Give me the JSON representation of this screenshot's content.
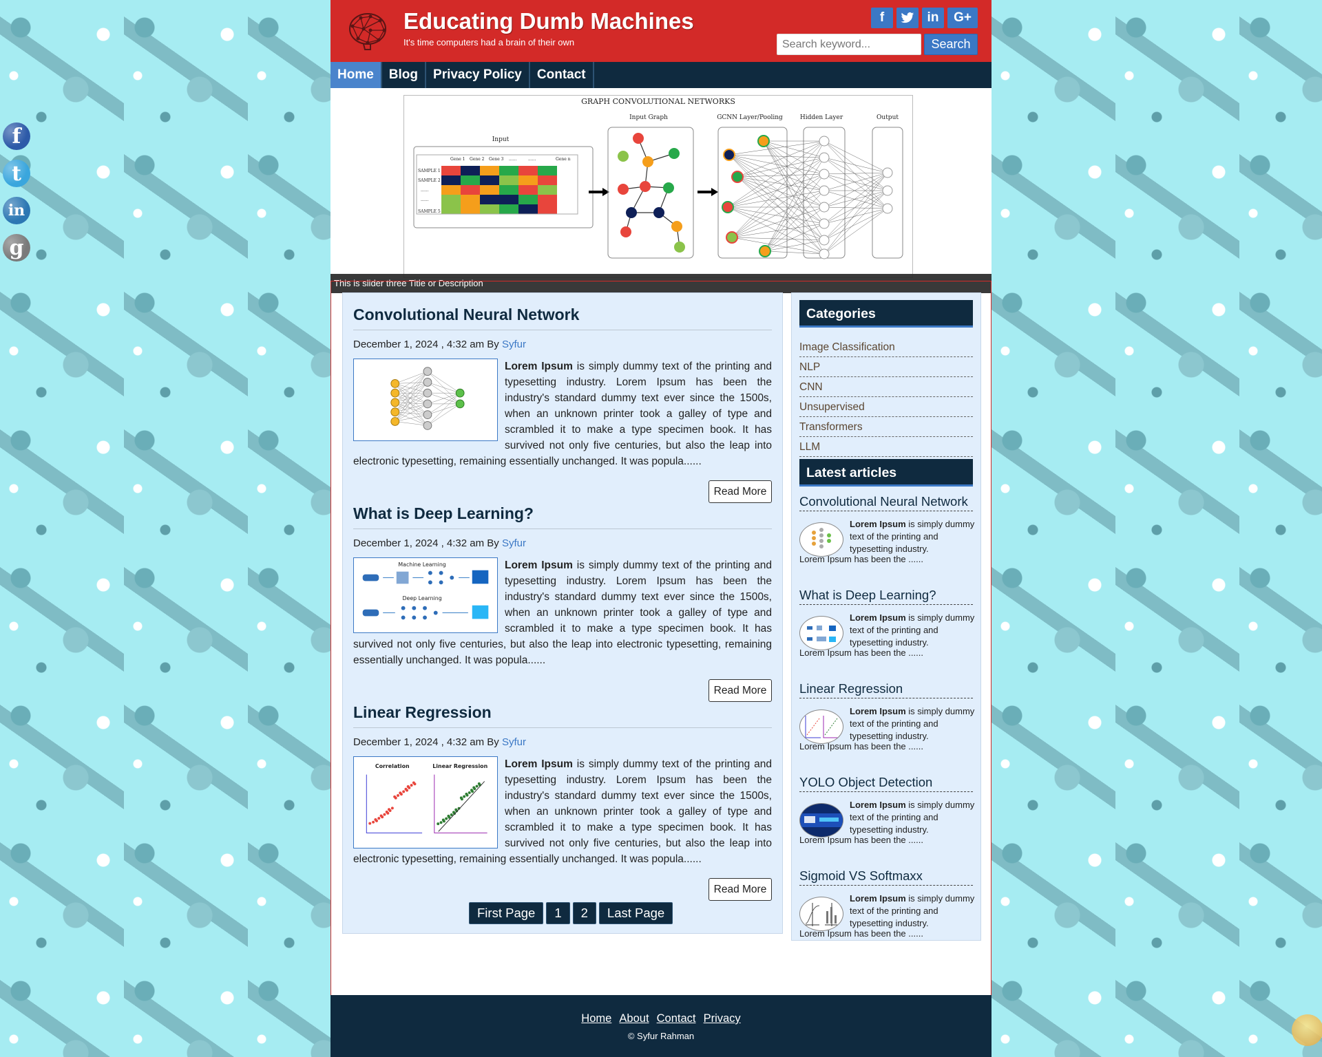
{
  "site": {
    "title": "Educating Dumb Machines",
    "tagline": "It's time computers had a brain of their own"
  },
  "search": {
    "placeholder": "Search keyword...",
    "button": "Search"
  },
  "header_social": [
    "f",
    "t",
    "in",
    "G+"
  ],
  "side_social": [
    "facebook-icon",
    "twitter-icon",
    "linkedin-icon",
    "google-icon"
  ],
  "nav": [
    {
      "label": "Home",
      "active": true
    },
    {
      "label": "Blog",
      "active": false
    },
    {
      "label": "Privacy Policy",
      "active": false
    },
    {
      "label": "Contact",
      "active": false
    }
  ],
  "slider": {
    "caption": "This is slider three Title or Description",
    "diagram_title": "GRAPH CONVOLUTIONAL NETWORKS",
    "labels": [
      "Input",
      "Input Graph",
      "GCNN Layer/Pooling",
      "Hidden Layer",
      "Output"
    ],
    "table_head": [
      "Gene 1",
      "Gene 2",
      "Gene 3",
      "......",
      "......",
      "Gene n"
    ],
    "table_rows": [
      "SAMPLE 1",
      "SAMPLE 2",
      "......",
      "......",
      "SAMPLE 5"
    ]
  },
  "posts": [
    {
      "title": "Convolutional Neural Network",
      "date": "December 1, 2024 , 4:32 am",
      "by": "By",
      "author": "Syfur",
      "lead": "Lorem Ipsum",
      "body": " is simply dummy text of the printing and typesetting industry. Lorem Ipsum has been the industry's standard dummy text ever since the 1500s, when an unknown printer took a galley of type and scrambled it to make a type specimen book. It has survived not only five centuries, but also the leap into electronic typesetting, remaining essentially unchanged. It was popula......",
      "read_more": "Read More"
    },
    {
      "title": "What is Deep Learning?",
      "date": "December 1, 2024 , 4:32 am",
      "by": "By",
      "author": "Syfur",
      "lead": "Lorem Ipsum",
      "body": " is simply dummy text of the printing and typesetting industry. Lorem Ipsum has been the industry's standard dummy text ever since the 1500s, when an unknown printer took a galley of type and scrambled it to make a type specimen book. It has survived not only five centuries, but also the leap into electronic typesetting, remaining essentially unchanged. It was popula......",
      "read_more": "Read More",
      "thumb_labels": [
        "Machine Learning",
        "Deep Learning"
      ]
    },
    {
      "title": "Linear Regression",
      "date": "December 1, 2024 , 4:32 am",
      "by": "By",
      "author": "Syfur",
      "lead": "Lorem Ipsum",
      "body": " is simply dummy text of the printing and typesetting industry. Lorem Ipsum has been the industry's standard dummy text ever since the 1500s, when an unknown printer took a galley of type and scrambled it to make a type specimen book. It has survived not only five centuries, but also the leap into electronic typesetting, remaining essentially unchanged. It was popula......",
      "read_more": "Read More",
      "thumb_labels": [
        "Correlation",
        "Linear Regression"
      ]
    }
  ],
  "pagination": [
    "First Page",
    "1",
    "2",
    "Last Page"
  ],
  "categories": {
    "title": "Categories",
    "items": [
      "Image Classification",
      "NLP",
      "CNN",
      "Unsupervised",
      "Transformers",
      "LLM"
    ]
  },
  "latest": {
    "title": "Latest articles",
    "items": [
      {
        "title": "Convolutional Neural Network",
        "lead": "Lorem Ipsum",
        "text": " is simply dummy text of the printing and typesetting industry.",
        "tail": "Lorem Ipsum has been the ......"
      },
      {
        "title": "What is Deep Learning?",
        "lead": "Lorem Ipsum",
        "text": " is simply dummy text of the printing and typesetting industry.",
        "tail": "Lorem Ipsum has been the ......"
      },
      {
        "title": "Linear Regression",
        "lead": "Lorem Ipsum",
        "text": " is simply dummy text of the printing and typesetting industry.",
        "tail": "Lorem Ipsum has been the ......"
      },
      {
        "title": "YOLO Object Detection",
        "lead": "Lorem Ipsum",
        "text": " is simply dummy text of the printing and typesetting industry.",
        "tail": "Lorem Ipsum has been the ......"
      },
      {
        "title": "Sigmoid VS Softmaxx",
        "lead": "Lorem Ipsum",
        "text": " is simply dummy text of the printing and typesetting industry.",
        "tail": "Lorem Ipsum has been the ......"
      }
    ]
  },
  "footer": {
    "links": [
      "Home",
      "About",
      "Contact",
      "Privacy"
    ],
    "copyright": "© Syfur Rahman"
  },
  "colors": {
    "header": "#d32a28",
    "navy": "#0f2a3f",
    "accent": "#3b78c5",
    "panel": "#e1eefc"
  }
}
